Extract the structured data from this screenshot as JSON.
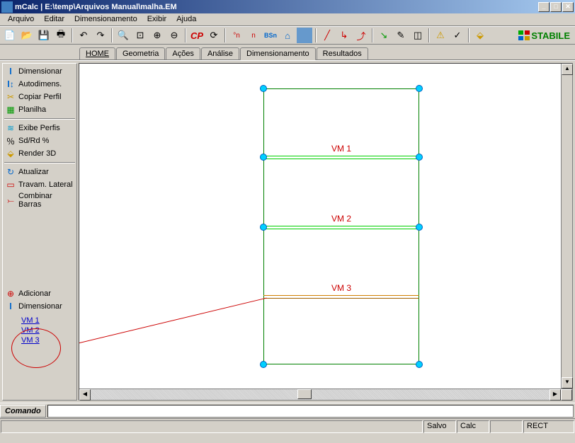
{
  "window": {
    "title": "mCalc  |  E:\\temp\\Arquivos Manual\\malha.EM"
  },
  "menu": [
    "Arquivo",
    "Editar",
    "Dimensionamento",
    "Exibir",
    "Ajuda"
  ],
  "tabs": [
    "HOME",
    "Geometria",
    "Ações",
    "Análise",
    "Dimensionamento",
    "Resultados"
  ],
  "active_tab": "Dimensionamento",
  "sidebar": {
    "group1": [
      {
        "label": "Dimensionar"
      },
      {
        "label": "Autodimens."
      },
      {
        "label": "Copiar Perfil"
      },
      {
        "label": "Planilha"
      }
    ],
    "group2": [
      {
        "label": "Exibe Perfis"
      },
      {
        "label": "Sd/Rd %"
      },
      {
        "label": "Render 3D"
      }
    ],
    "group3": [
      {
        "label": "Atualizar"
      },
      {
        "label": "Travam. Lateral"
      },
      {
        "label": "Combinar Barras"
      }
    ],
    "group4": [
      {
        "label": "Adicionar"
      },
      {
        "label": "Dimensionar"
      }
    ],
    "links": [
      "VM 1",
      "VM 2",
      "VM 3"
    ]
  },
  "canvas": {
    "beams": [
      {
        "label": "VM 1"
      },
      {
        "label": "VM 2"
      },
      {
        "label": "VM 3"
      }
    ]
  },
  "toolbar_text": {
    "cp": "CP",
    "circ_n": "°n",
    "n": "n",
    "bsn": "BSn"
  },
  "brand": "STABILE",
  "command": {
    "label": "Comando"
  },
  "status": {
    "s1": "Salvo",
    "s2": "Calc",
    "s3": "RECT"
  }
}
